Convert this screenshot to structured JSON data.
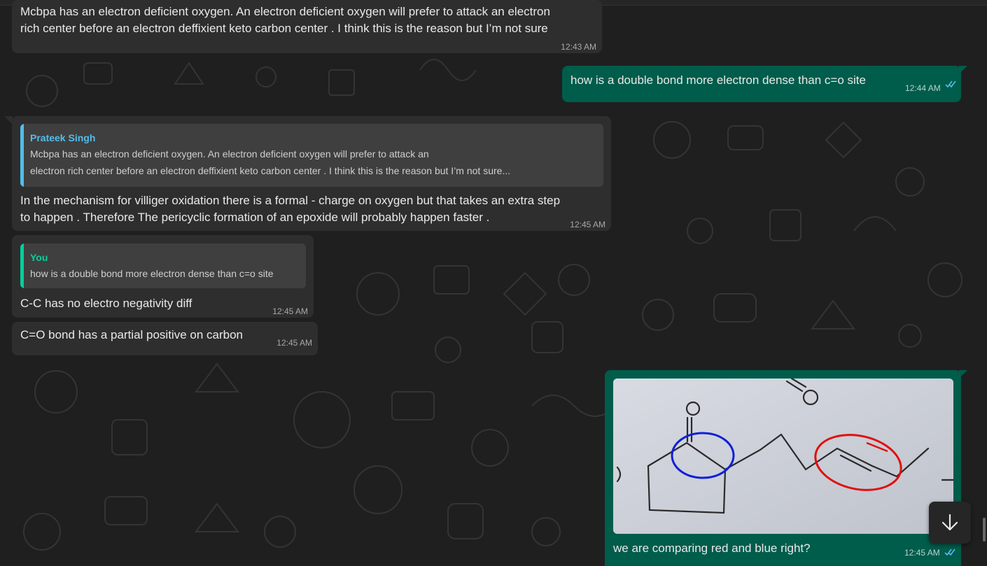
{
  "messages": [
    {
      "direction": "incoming",
      "lines": [
        "Mcbpa has an electron deficient oxygen. An electron deficient oxygen will prefer to attack an electron",
        "rich center before an electron deffixient keto carbon center . I think this is the reason but I’m not sure"
      ],
      "time": "12:43 AM"
    },
    {
      "direction": "outgoing",
      "text": "how is a double bond more electron dense than c=o site",
      "time": "12:44 AM",
      "status": "read"
    },
    {
      "direction": "incoming",
      "quote": {
        "author": "Prateek Singh",
        "lines": [
          "Mcbpa has an electron deficient oxygen. An electron deficient oxygen will prefer to attack an",
          "electron rich center before an electron deffixient keto carbon center . I think this is the reason but I’m not sure..."
        ]
      },
      "lines": [
        "In the mechanism for villiger oxidation there is a formal - charge on oxygen but that takes an extra step",
        "to happen . Therefore The pericyclic formation of an epoxide will probably happen faster ."
      ],
      "time": "12:45 AM"
    },
    {
      "direction": "incoming",
      "quote": {
        "author": "You",
        "lines": [
          "how is a double bond more electron dense than c=o site"
        ]
      },
      "text": "C-C has no electro negativity diff",
      "time": "12:45 AM"
    },
    {
      "direction": "incoming",
      "text": "C=O bond has a partial positive on carbon",
      "time": "12:45 AM"
    },
    {
      "direction": "outgoing",
      "image": "photo of a skeletal structure with a blue circle around the ketone carbon and a red circle around the C=C double bond",
      "caption": "we are comparing red and blue right?",
      "time": "12:45 AM",
      "status": "read"
    }
  ],
  "icons": {
    "read_ticks": "double-check-icon",
    "scroll_down": "arrow-down-icon"
  },
  "colors": {
    "outgoing_bubble": "#005c4b",
    "incoming_bubble": "#2e2e2e",
    "quote_bar_other": "#53bdeb",
    "quote_bar_you": "#06cf9c",
    "read_tick": "#53bdeb",
    "annotation_blue": "#1020d8",
    "annotation_red": "#e01010"
  }
}
